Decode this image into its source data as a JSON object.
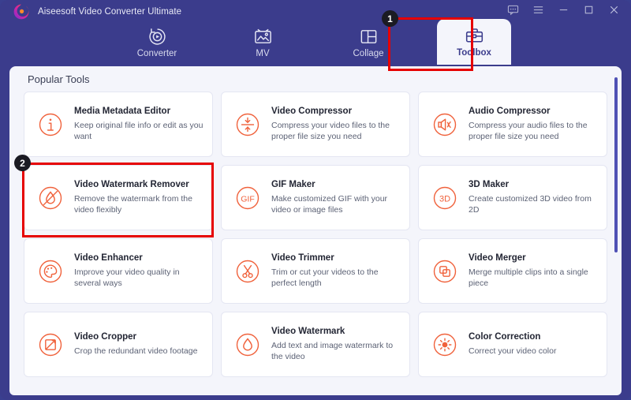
{
  "window": {
    "app_title": "Aiseesoft Video Converter Ultimate",
    "logo": "aiseesoft-logo",
    "controls": [
      {
        "name": "feedback-icon",
        "label": "Feedback"
      },
      {
        "name": "menu-icon",
        "label": "Menu"
      },
      {
        "name": "minimize-icon",
        "label": "Minimize"
      },
      {
        "name": "maximize-icon",
        "label": "Maximize"
      },
      {
        "name": "close-icon",
        "label": "Close"
      }
    ]
  },
  "nav": {
    "tabs": [
      {
        "label": "Converter",
        "icon": "converter-icon",
        "active": false
      },
      {
        "label": "MV",
        "icon": "mv-icon",
        "active": false
      },
      {
        "label": "Collage",
        "icon": "collage-icon",
        "active": false
      },
      {
        "label": "Toolbox",
        "icon": "toolbox-icon",
        "active": true
      }
    ]
  },
  "main": {
    "section_title": "Popular Tools",
    "cards": [
      {
        "title": "Media Metadata Editor",
        "desc": "Keep original file info or edit as you want",
        "icon": "info-icon"
      },
      {
        "title": "Video Compressor",
        "desc": "Compress your video files to the proper file size you need",
        "icon": "compress-icon"
      },
      {
        "title": "Audio Compressor",
        "desc": "Compress your audio files to the proper file size you need",
        "icon": "speaker-icon"
      },
      {
        "title": "Video Watermark Remover",
        "desc": "Remove the watermark from the video flexibly",
        "icon": "watermark-remove-icon"
      },
      {
        "title": "GIF Maker",
        "desc": "Make customized GIF with your video or image files",
        "icon": "gif-icon"
      },
      {
        "title": "3D Maker",
        "desc": "Create customized 3D video from 2D",
        "icon": "3d-icon"
      },
      {
        "title": "Video Enhancer",
        "desc": "Improve your video quality in several ways",
        "icon": "palette-icon"
      },
      {
        "title": "Video Trimmer",
        "desc": "Trim or cut your videos to the perfect length",
        "icon": "scissors-icon"
      },
      {
        "title": "Video Merger",
        "desc": "Merge multiple clips into a single piece",
        "icon": "merge-icon"
      },
      {
        "title": "Video Cropper",
        "desc": "Crop the redundant video footage",
        "icon": "crop-icon"
      },
      {
        "title": "Video Watermark",
        "desc": "Add text and image watermark to the video",
        "icon": "droplet-icon"
      },
      {
        "title": "Color Correction",
        "desc": "Correct your video color",
        "icon": "brightness-icon"
      }
    ]
  },
  "annotations": {
    "step_one": "1",
    "step_two": "2",
    "highlight_color": "#e60000"
  }
}
